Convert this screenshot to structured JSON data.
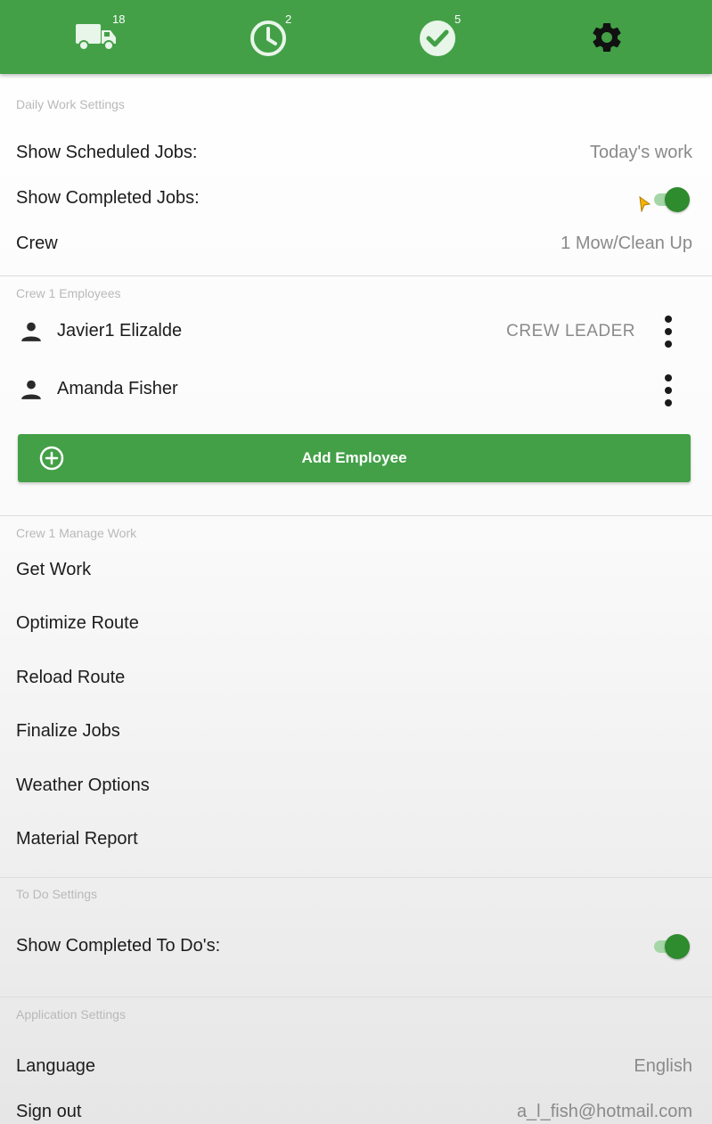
{
  "nav": {
    "tabs": [
      {
        "icon": "truck-icon",
        "badge": "18"
      },
      {
        "icon": "clock-icon",
        "badge": "2"
      },
      {
        "icon": "check-circle-icon",
        "badge": "5"
      },
      {
        "icon": "gear-icon",
        "badge": ""
      }
    ],
    "active_tab": 3
  },
  "daily_work": {
    "section_label": "Daily Work Settings",
    "show_scheduled_label": "Show Scheduled Jobs:",
    "show_scheduled_value": "Today's work",
    "show_completed_label": "Show Completed Jobs:",
    "show_completed_on": true,
    "crew_label": "Crew",
    "crew_value": "1 Mow/Clean Up"
  },
  "employees": {
    "section_label": "Crew 1 Employees",
    "items": [
      {
        "name": "Javier1 Elizalde",
        "role": "CREW LEADER"
      },
      {
        "name": "Amanda Fisher",
        "role": ""
      }
    ],
    "add_label": "Add Employee"
  },
  "manage_work": {
    "section_label": "Crew 1 Manage Work",
    "items": [
      "Get Work",
      "Optimize Route",
      "Reload Route",
      "Finalize Jobs",
      "Weather Options",
      "Material Report"
    ]
  },
  "todo": {
    "section_label": "To Do Settings",
    "show_completed_label": "Show Completed To Do's:",
    "show_completed_on": true
  },
  "app_settings": {
    "section_label": "Application Settings",
    "language_label": "Language",
    "language_value": "English",
    "signout_label": "Sign out",
    "signout_value": "a_l_fish@hotmail.com"
  },
  "colors": {
    "accent": "#43a047",
    "toggle_on": "#2e8b2e"
  }
}
